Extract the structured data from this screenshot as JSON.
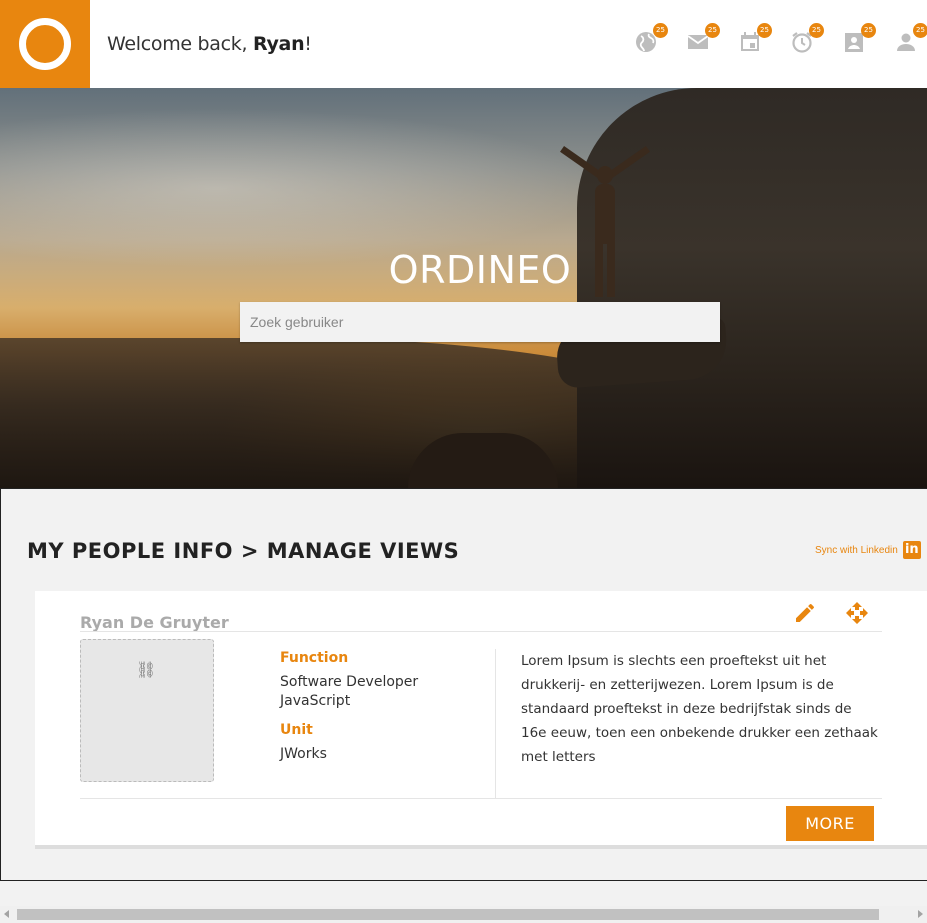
{
  "header": {
    "welcome_prefix": "Welcome back, ",
    "user_name": "Ryan",
    "welcome_suffix": "!",
    "icons": [
      {
        "name": "globe-icon",
        "badge": "25"
      },
      {
        "name": "mail-icon",
        "badge": "25"
      },
      {
        "name": "calendar-icon",
        "badge": "25"
      },
      {
        "name": "alarm-clock-icon",
        "badge": "25"
      },
      {
        "name": "contact-card-icon",
        "badge": "25"
      },
      {
        "name": "person-icon",
        "badge": "25"
      }
    ],
    "accent_color": "#e8860f"
  },
  "hero": {
    "title": "ORDINEO",
    "search_placeholder": "Zoek gebruiker"
  },
  "section": {
    "title": "MY PEOPLE INFO > MANAGE VIEWS",
    "sync_label": "Sync with Linkedin",
    "linkedin_icon_text": "in"
  },
  "card": {
    "name": "Ryan De Gruyter",
    "function_label": "Function",
    "function_value_1": "Software Developer",
    "function_value_2": "JavaScript",
    "unit_label": "Unit",
    "unit_value": "JWorks",
    "description": "Lorem Ipsum is slechts een proeftekst uit het drukkerij- en zetterijwezen. Lorem Ipsum is de standaard proeftekst in deze bedrijfstak sinds de 16e eeuw, toen een onbekende drukker een zethaak met letters",
    "more_label": "MORE"
  }
}
